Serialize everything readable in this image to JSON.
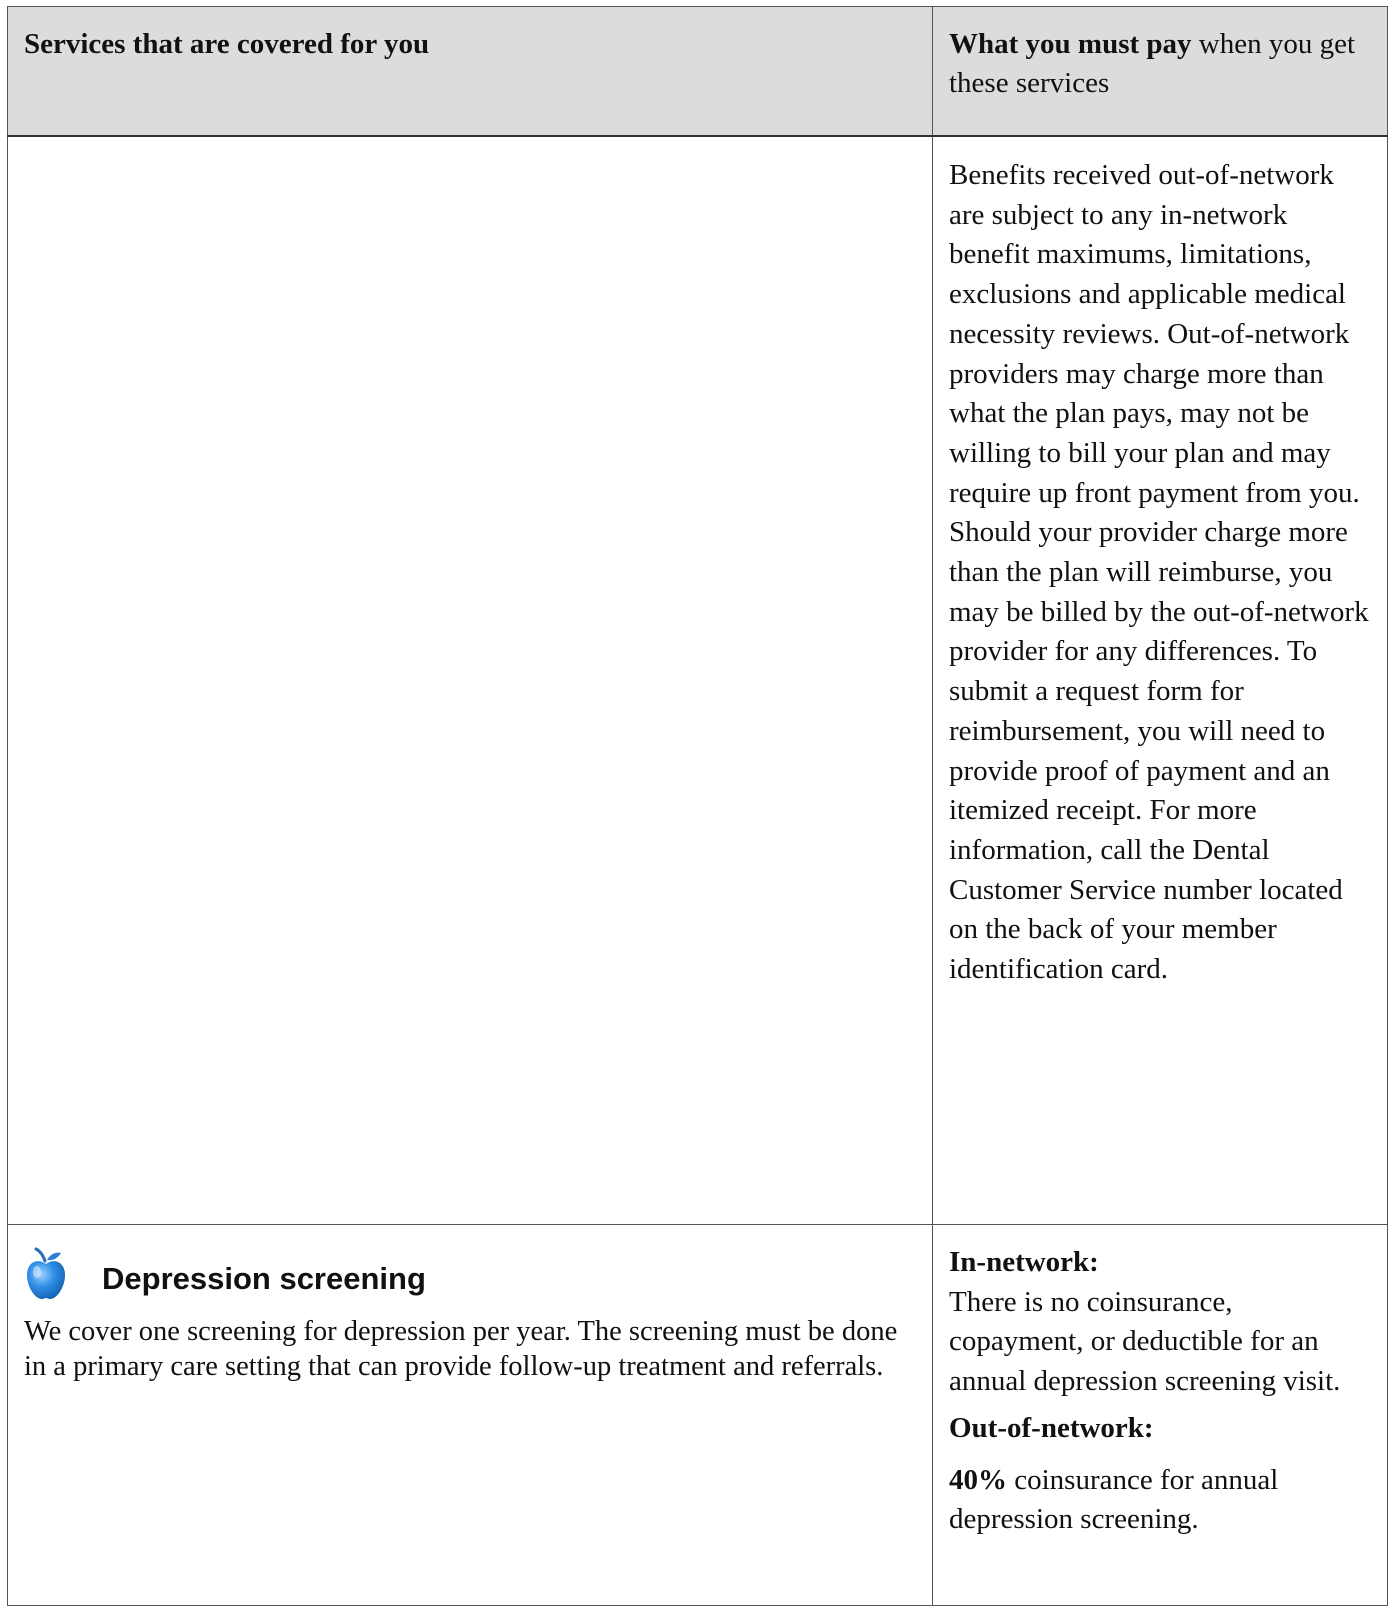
{
  "header": {
    "left": "Services that are covered for you",
    "right_bold": "What you must pay",
    "right_rest": " when you get these services"
  },
  "row1": {
    "right_text": "Benefits received out-of-network are subject to any in-network benefit maximums, limitations, exclusions and applicable medical necessity reviews. Out-of-network providers may charge more than what the plan pays, may not be willing to bill your plan and may require up front payment from you. Should your provider charge more than the plan will reimburse, you may be billed by the out-of-network provider for any differences. To submit a request form for reimbursement, you will need to provide proof of payment and an itemized receipt. For more information, call the Dental Customer Service number located on the back of your member identification card."
  },
  "row2": {
    "icon": "apple-icon",
    "title": "Depression screening",
    "description": "We cover one screening for depression per year. The screening must be done in a primary care setting that can provide follow-up treatment and referrals.",
    "in_network_label": "In-network:",
    "in_network_text": "There is no coinsurance, copayment, or deductible for an annual depression screening visit.",
    "out_network_label": "Out-of-network:",
    "out_network_bold": "40%",
    "out_network_text": " coinsurance for annual depression screening."
  },
  "colors": {
    "header_bg": "#dcdcdc",
    "border": "#555555",
    "apple_blue": "#1f7fd6"
  }
}
